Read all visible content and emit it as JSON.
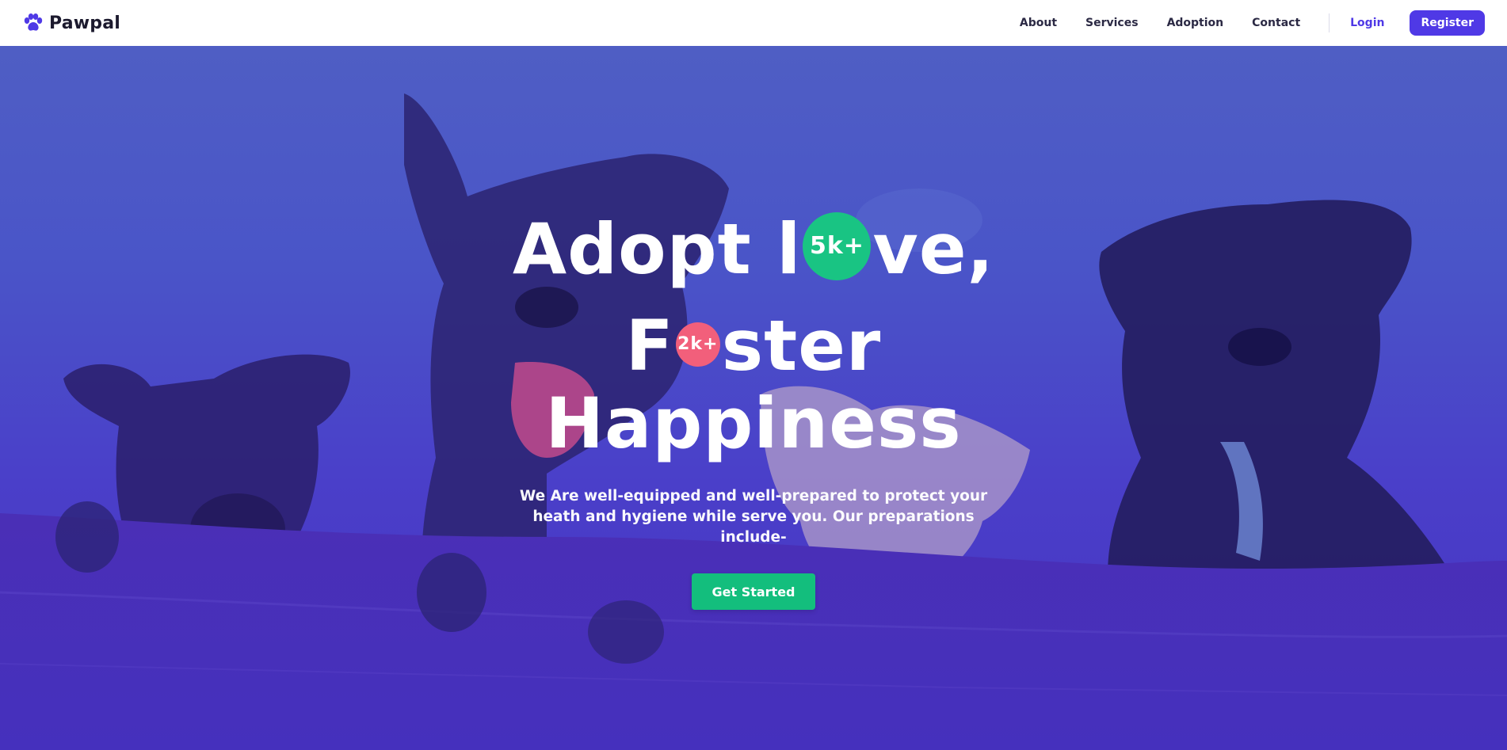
{
  "brand": {
    "name": "Pawpal",
    "icon": "paw-icon",
    "color": "#4f39e6"
  },
  "nav": {
    "links": [
      "About",
      "Services",
      "Adoption",
      "Contact"
    ],
    "login": "Login",
    "register": "Register"
  },
  "hero": {
    "line1_before": "Adopt l",
    "line1_badge": "5k+",
    "line1_after": "ve,",
    "line2_before": "F",
    "line2_badge": "2k+",
    "line2_after": "ster",
    "line3": "Happiness",
    "subtext": "We Are well-equipped and well-prepared to protect your heath and hygiene while serve you. Our preparations include-",
    "cta": "Get Started"
  },
  "colors": {
    "accent": "#4f39e6",
    "hero_overlay": "#4a3fc9",
    "badge_green": "#19c483",
    "badge_pink": "#f25f7b",
    "cta": "#13be7d"
  }
}
